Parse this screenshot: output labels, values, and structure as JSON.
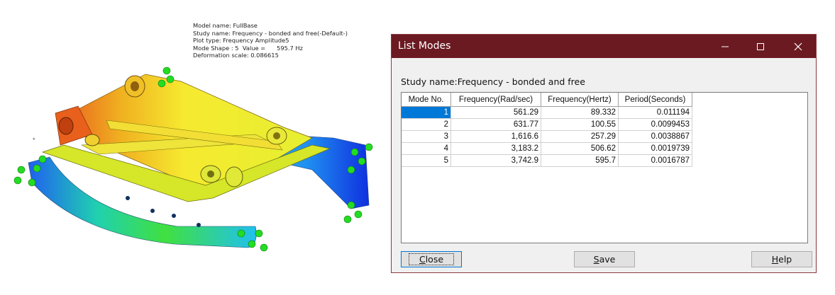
{
  "model_info": {
    "model_name": "Model name: FullBase",
    "study_name": "Study name: Frequency - bonded and free(-Default-)",
    "plot_type": "Plot type: Frequency Amplitude5",
    "mode_shape": "Mode Shape : 5  Value =      595.7 Hz",
    "deformation_scale": "Deformation scale: 0.086615"
  },
  "origin_mark": "*",
  "dialog": {
    "title": "List Modes",
    "study_label": "Study name:Frequency - bonded and free",
    "columns": [
      "Mode No.",
      "Frequency(Rad/sec)",
      "Frequency(Hertz)",
      "Period(Seconds)"
    ],
    "rows": [
      [
        "1",
        "561.29",
        "89.332",
        "0.011194"
      ],
      [
        "2",
        "631.77",
        "100.55",
        "0.0099453"
      ],
      [
        "3",
        "1,616.6",
        "257.29",
        "0.0038867"
      ],
      [
        "4",
        "3,183.2",
        "506.62",
        "0.0019739"
      ],
      [
        "5",
        "3,742.9",
        "595.7",
        "0.0016787"
      ]
    ],
    "selected_row": 0,
    "buttons": {
      "close_mnemonic": "C",
      "close_rest": "lose",
      "save_mnemonic": "S",
      "save_rest": "ave",
      "help_mnemonic": "H",
      "help_rest": "elp"
    }
  },
  "colors": {
    "titlebar": "#6b1a22",
    "selection": "#0078d7"
  }
}
